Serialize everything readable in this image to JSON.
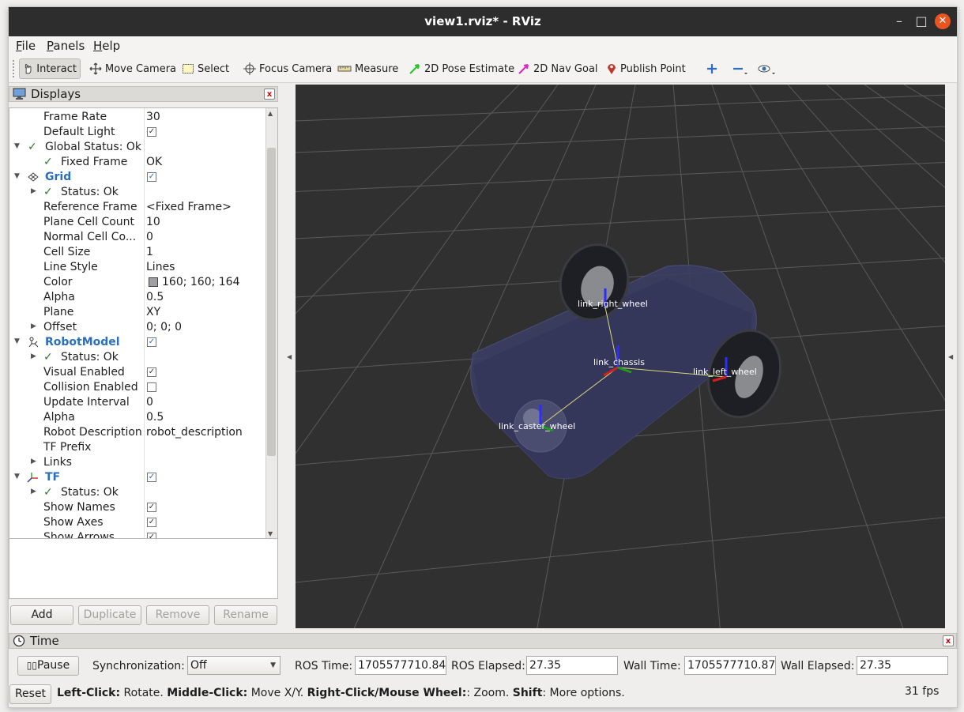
{
  "window": {
    "title": "view1.rviz* - RViz",
    "minimize": "–",
    "maximize": "□",
    "close": "✕"
  },
  "menu": [
    {
      "key": "F",
      "rest": "ile"
    },
    {
      "key": "P",
      "rest": "anels"
    },
    {
      "key": "H",
      "rest": "elp"
    }
  ],
  "toolbar": {
    "interact": "Interact",
    "move_camera": "Move Camera",
    "select": "Select",
    "focus_camera": "Focus Camera",
    "measure": "Measure",
    "pose_estimate": "2D Pose Estimate",
    "nav_goal": "2D Nav Goal",
    "publish_point": "Publish Point"
  },
  "displays": {
    "title": "Displays",
    "close": "x",
    "rows": {
      "frame_rate": {
        "name": "Frame Rate",
        "value": "30"
      },
      "default_light": {
        "name": "Default Light"
      },
      "global_status": {
        "name": "Global Status: Ok"
      },
      "fixed_frame": {
        "name": "Fixed Frame",
        "value": "OK"
      },
      "grid": {
        "name": "Grid"
      },
      "grid_status": {
        "name": "Status: Ok"
      },
      "reference_frame": {
        "name": "Reference Frame",
        "value": "<Fixed Frame>"
      },
      "plane_cell_count": {
        "name": "Plane Cell Count",
        "value": "10"
      },
      "normal_cell_count": {
        "name": "Normal Cell Co...",
        "value": "0"
      },
      "cell_size": {
        "name": "Cell Size",
        "value": "1"
      },
      "line_style": {
        "name": "Line Style",
        "value": "Lines"
      },
      "color": {
        "name": "Color",
        "value": "160; 160; 164",
        "swatch": "#a0a0a4"
      },
      "alpha": {
        "name": "Alpha",
        "value": "0.5"
      },
      "plane": {
        "name": "Plane",
        "value": "XY"
      },
      "offset": {
        "name": "Offset",
        "value": "0; 0; 0"
      },
      "robot_model": {
        "name": "RobotModel"
      },
      "rm_status": {
        "name": "Status: Ok"
      },
      "visual_enabled": {
        "name": "Visual Enabled"
      },
      "collision_enabled": {
        "name": "Collision Enabled"
      },
      "update_interval": {
        "name": "Update Interval",
        "value": "0"
      },
      "rm_alpha": {
        "name": "Alpha",
        "value": "0.5"
      },
      "robot_description": {
        "name": "Robot Description",
        "value": "robot_description"
      },
      "tf_prefix": {
        "name": "TF Prefix"
      },
      "links": {
        "name": "Links"
      },
      "tf": {
        "name": "TF"
      },
      "tf_status": {
        "name": "Status: Ok"
      },
      "show_names": {
        "name": "Show Names"
      },
      "show_axes": {
        "name": "Show Axes"
      },
      "show_arrows": {
        "name": "Show Arrows"
      }
    },
    "buttons": {
      "add": "Add",
      "duplicate": "Duplicate",
      "remove": "Remove",
      "rename": "Rename"
    }
  },
  "viewport": {
    "labels": {
      "right_wheel": "link_right_wheel",
      "chassis": "link_chassis",
      "left_wheel": "link_left_wheel",
      "caster_wheel": "link_caster_wheel"
    }
  },
  "time": {
    "title": "Time",
    "pause": "Pause",
    "sync_label": "Synchronization:",
    "sync_value": "Off",
    "ros_time_label": "ROS Time:",
    "ros_time": "1705577710.84",
    "ros_elapsed_label": "ROS Elapsed:",
    "ros_elapsed": "27.35",
    "wall_time_label": "Wall Time:",
    "wall_time": "1705577710.87",
    "wall_elapsed_label": "Wall Elapsed:",
    "wall_elapsed": "27.35"
  },
  "status": {
    "reset": "Reset",
    "b1": "Left-Click:",
    "t1": " Rotate. ",
    "b2": "Middle-Click:",
    "t2": " Move X/Y. ",
    "b3": "Right-Click/Mouse Wheel:",
    "t3": ": Zoom. ",
    "b4": "Shift",
    "t4": ": More options.",
    "fps": "31 fps"
  }
}
